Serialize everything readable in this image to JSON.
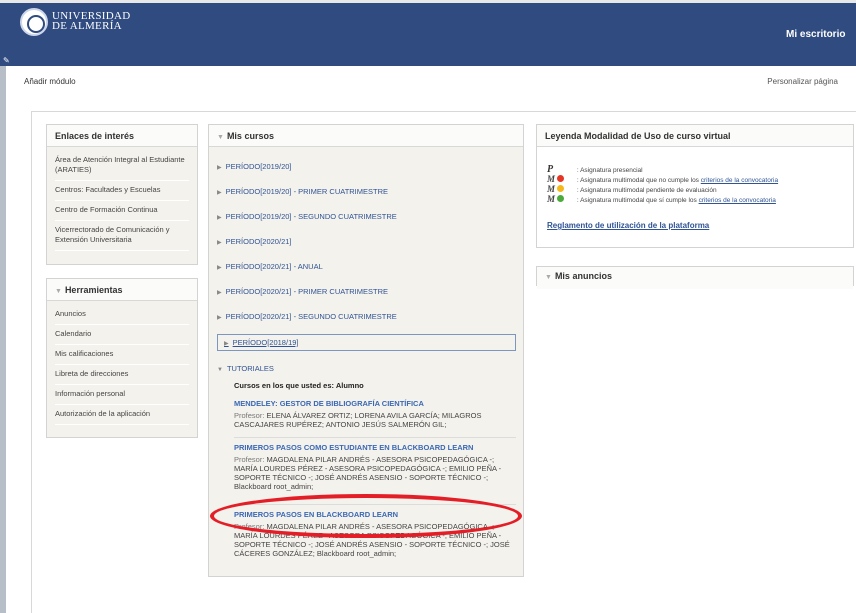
{
  "header": {
    "logo_line1": "UNIVERSIDAD",
    "logo_line2": "DE ALMERÍA",
    "tab_label": "Mi escritorio",
    "color": "#2f4b80"
  },
  "toolbar": {
    "add_module": "Añadir módulo",
    "customize": "Personalizar página"
  },
  "enlaces": {
    "title": "Enlaces de interés",
    "items": [
      "Área de Atención Integral al Estudiante (ARATIES)",
      "Centros: Facultades y Escuelas",
      "Centro de Formación Continua",
      "Vicerrectorado de Comunicación y Extensión Universitaria"
    ]
  },
  "herramientas": {
    "title": "Herramientas",
    "items": [
      "Anuncios",
      "Calendario",
      "Mis calificaciones",
      "Libreta de direcciones",
      "Información personal",
      "Autorización de la aplicación"
    ]
  },
  "mis_cursos": {
    "title": "Mis cursos",
    "periods": [
      "PERÍODO[2019/20]",
      "PERÍODO[2019/20] - PRIMER CUATRIMESTRE",
      "PERÍODO[2019/20] - SEGUNDO CUATRIMESTRE",
      "PERÍODO[2020/21]",
      "PERÍODO[2020/21] - ANUAL",
      "PERÍODO[2020/21] - PRIMER CUATRIMESTRE",
      "PERÍODO[2020/21] - SEGUNDO CUATRIMESTRE",
      "PERÍODO[2018/19]",
      "TUTORIALES"
    ],
    "role_text": "Cursos en los que usted es: Alumno",
    "professor_label": "Profesor:",
    "courses": [
      {
        "title": "MENDELEY: GESTOR DE BIBLIOGRAFÍA CIENTÍFICA",
        "professors": "ELENA ÁLVAREZ ORTIZ;  LORENA AVILA GARCÍA;  MILAGROS CASCAJARES RUPÉREZ;  ANTONIO JESÚS SALMERÓN GIL;"
      },
      {
        "title": "PRIMEROS PASOS COMO ESTUDIANTE EN BLACKBOARD LEARN",
        "professors": "MAGDALENA PILAR ANDRÉS - ASESORA PSICOPEDAGÓGICA -;  MARÍA LOURDES PÉREZ - ASESORA PSICOPEDAGÓGICA -;  EMILIO PEÑA - SOPORTE TÉCNICO -;  JOSÉ ANDRÉS ASENSIO - SOPORTE TÉCNICO -;  Blackboard root_admin;"
      },
      {
        "title": "PRIMEROS PASOS EN BLACKBOARD LEARN",
        "professors": "MAGDALENA PILAR ANDRÉS - ASESORA PSICOPEDAGÓGICA -;  MARÍA LOURDES PÉREZ - ASESORA PSICOPEDAGÓGICA -;  EMILIO PEÑA - SOPORTE TÉCNICO -;  JOSÉ ANDRÉS ASENSIO - SOPORTE TÉCNICO -;  JOSÉ CÁCERES GONZÁLEZ;  Blackboard root_admin;"
      }
    ]
  },
  "leyenda": {
    "title": "Leyenda Modalidad de Uso de curso virtual",
    "items": [
      {
        "text": ": Asignatura presencial",
        "link": ""
      },
      {
        "text": ": Asignatura multimodal que no cumple los ",
        "link": "criterios de la convocatoria"
      },
      {
        "text": ": Asignatura multimodal pendiente de evaluación",
        "link": ""
      },
      {
        "text": ": Asignatura multimodal que sí cumple los ",
        "link": "criterios de la convocatoria"
      }
    ],
    "reglamento": "Reglamento de utilización de la plataforma"
  },
  "anuncios": {
    "title": "Mis anuncios"
  },
  "colors": {
    "accent": "#2f5394",
    "highlight_ring": "#e41e26"
  }
}
